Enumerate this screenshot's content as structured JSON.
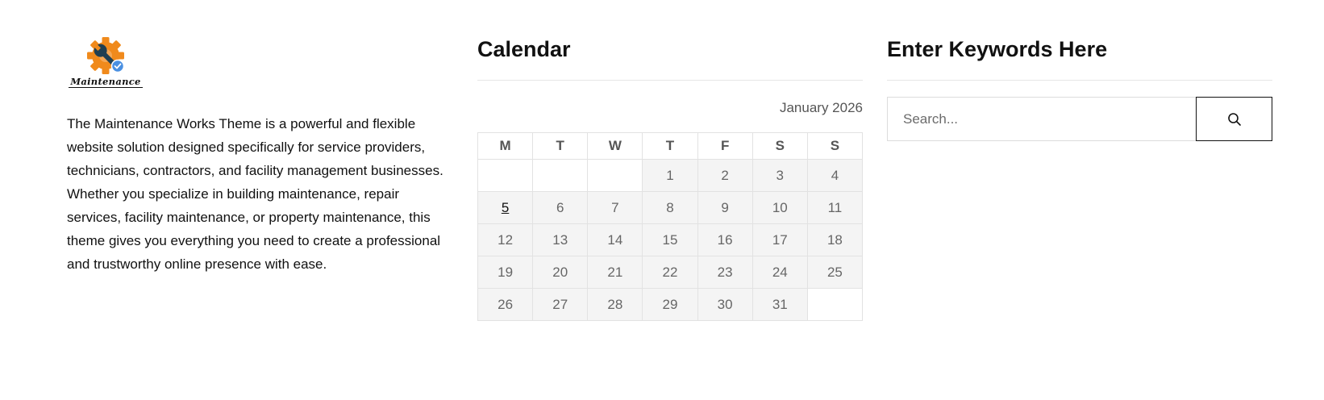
{
  "brand": {
    "logo_text": "Maintenance",
    "colors": {
      "gear": "#f08a1c",
      "wrench": "#1f3f52",
      "badge": "#4a90e2"
    }
  },
  "about": {
    "text": "The Maintenance Works Theme is a powerful and flexible website solution designed specifically for service providers, technicians, contractors, and facility management businesses. Whether you specialize in building maintenance, repair services, facility maintenance, or property maintenance, this theme gives you everything you need to create a professional and trustworthy online presence with ease."
  },
  "calendar": {
    "title": "Calendar",
    "caption": "January 2026",
    "weekdays": [
      "M",
      "T",
      "W",
      "T",
      "F",
      "S",
      "S"
    ],
    "weeks": [
      [
        "",
        "",
        "",
        "1",
        "2",
        "3",
        "4"
      ],
      [
        "5",
        "6",
        "7",
        "8",
        "9",
        "10",
        "11"
      ],
      [
        "12",
        "13",
        "14",
        "15",
        "16",
        "17",
        "18"
      ],
      [
        "19",
        "20",
        "21",
        "22",
        "23",
        "24",
        "25"
      ],
      [
        "26",
        "27",
        "28",
        "29",
        "30",
        "31",
        ""
      ]
    ],
    "today": "5"
  },
  "search": {
    "title": "Enter Keywords Here",
    "placeholder": "Search...",
    "button_icon": "search-icon"
  }
}
